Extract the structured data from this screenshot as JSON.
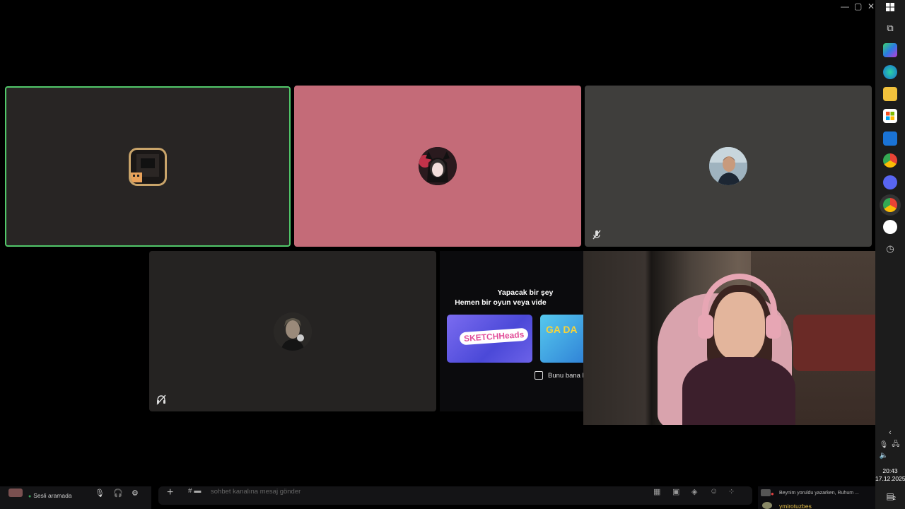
{
  "window": {
    "controls": [
      "—",
      "▢",
      "✕"
    ]
  },
  "tiles": {
    "t1": {
      "avatar": "pixel-cat-avatar",
      "speaking": true
    },
    "t2": {
      "avatar": "anime-girl-avatar",
      "color": "#c46b78"
    },
    "t3": {
      "avatar": "man-avatar",
      "muted": true
    },
    "t4": {
      "avatar": "dark-portrait-avatar",
      "deafened": true
    }
  },
  "activity": {
    "line1": "Yapacak bir şey",
    "line2": "Hemen bir oyun veya vide",
    "card1_logo": "SKETCHHeads",
    "card2_logo": "GA DA",
    "checkbox_label": "Bunu bana b"
  },
  "taskbar": {
    "time": "20:43",
    "date": "17.12.2025",
    "notifications": "2"
  },
  "user_panel": {
    "status": "Sesli aramada"
  },
  "message": {
    "placeholder": "sohbet kanalına mesaj gönder"
  },
  "chat": {
    "line1": "Beynim yoruldu yazarken, Ruhum ...",
    "line2": "ymirotuzbes"
  }
}
